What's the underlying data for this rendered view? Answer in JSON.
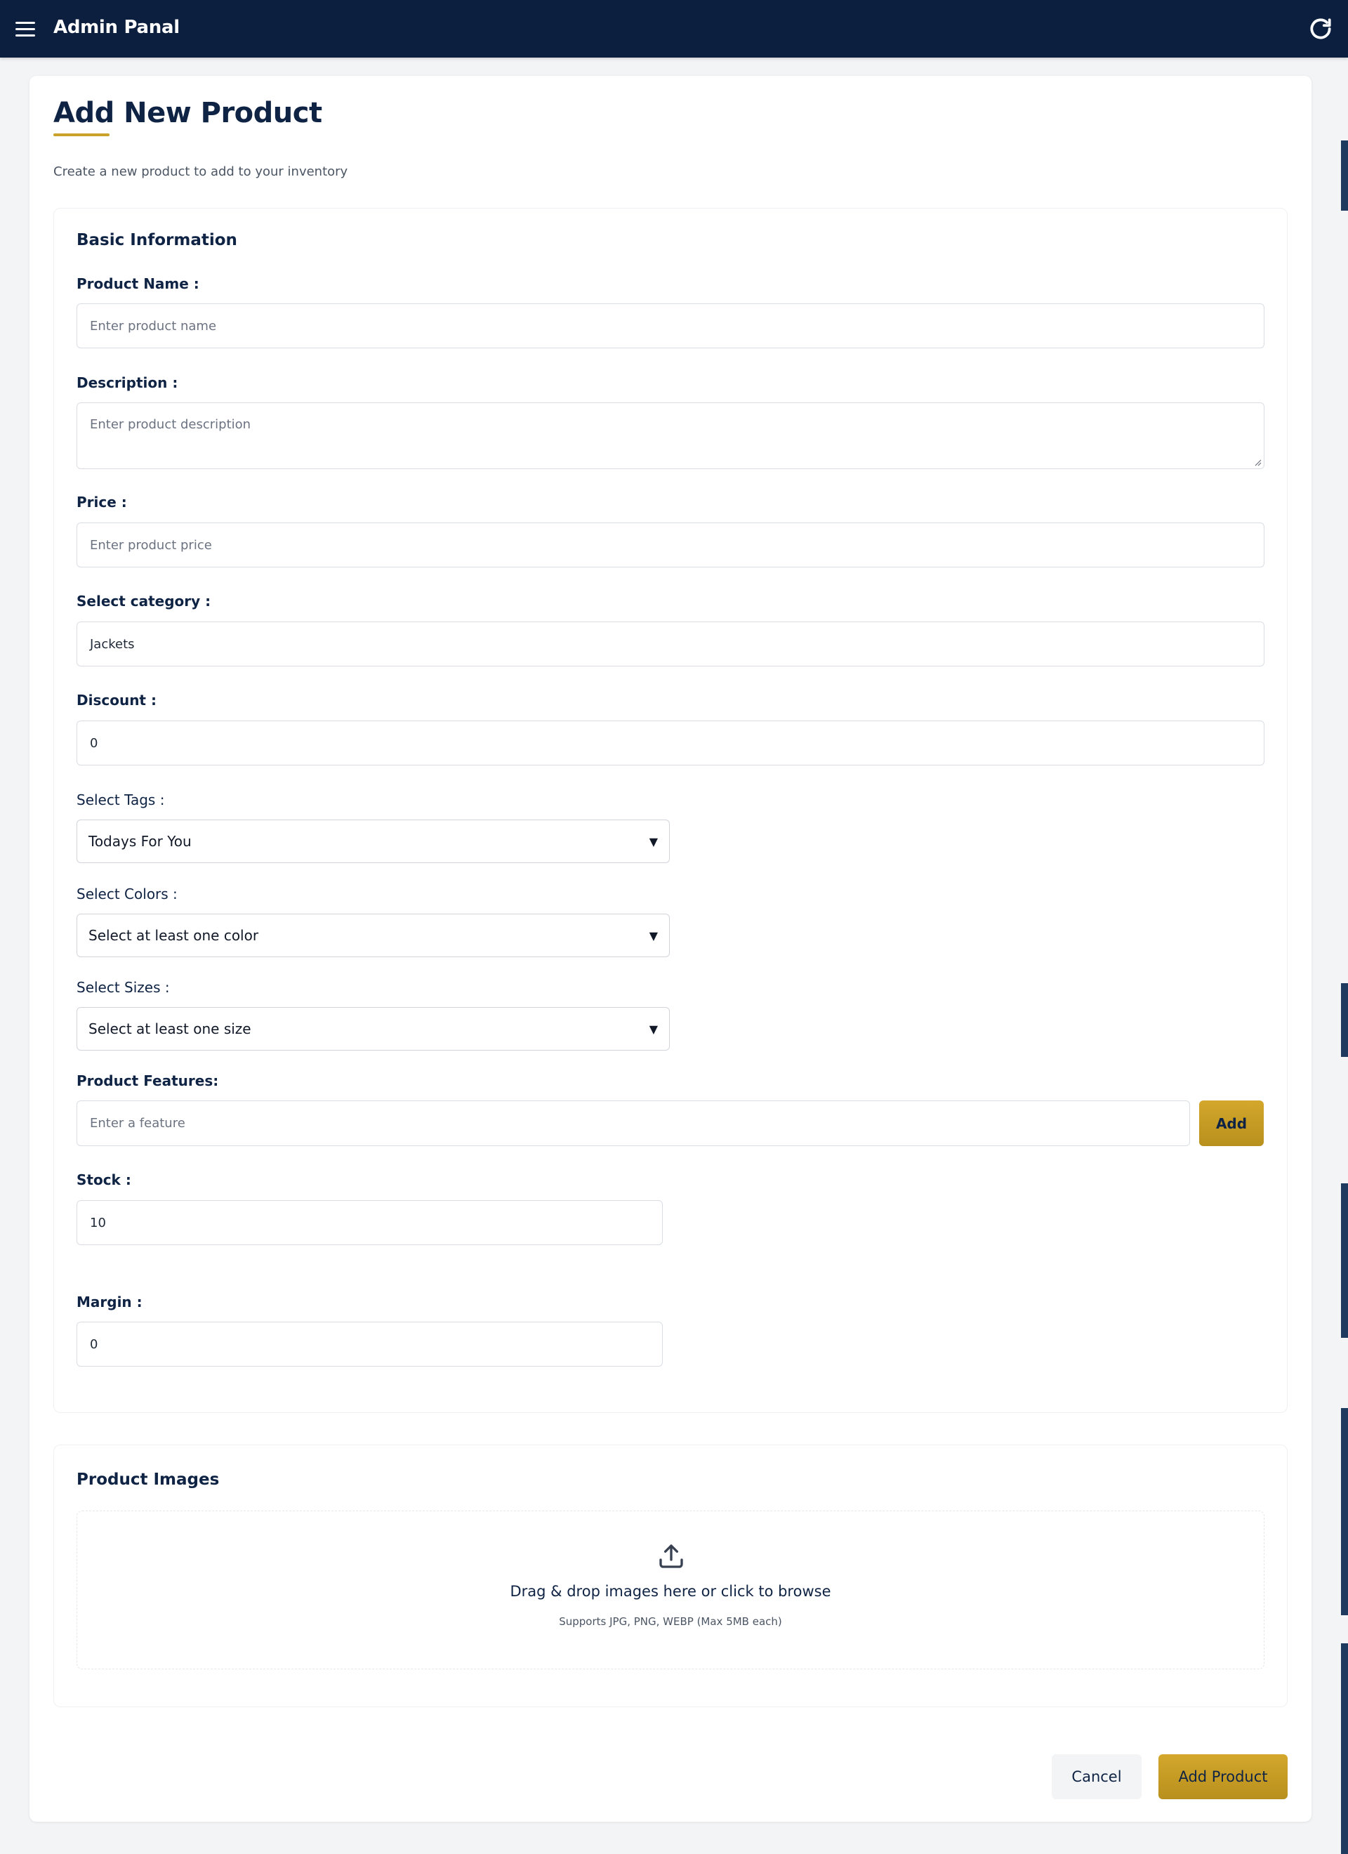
{
  "header": {
    "app_title": "Admin Panal",
    "menu_icon": "hamburger-menu-icon",
    "refresh_icon": "refresh-icon"
  },
  "page": {
    "title": "Add New Product",
    "subtitle": "Create a new product to add to your inventory"
  },
  "basic_info": {
    "title": "Basic Information",
    "product_name": {
      "label": "Product Name :",
      "placeholder": "Enter product name",
      "value": ""
    },
    "description": {
      "label": "Description :",
      "placeholder": "Enter product description",
      "value": ""
    },
    "price": {
      "label": "Price :",
      "placeholder": "Enter product price",
      "value": ""
    },
    "category": {
      "label": "Select category :",
      "value": "Jackets"
    },
    "discount": {
      "label": "Discount :",
      "value": "0"
    },
    "tags": {
      "label": "Select Tags :",
      "selected": "Todays For You"
    },
    "colors": {
      "label": "Select Colors :",
      "selected": "Select at least one color"
    },
    "sizes": {
      "label": "Select Sizes :",
      "selected": "Select at least one size"
    },
    "features": {
      "label": "Product Features:",
      "placeholder": "Enter a feature",
      "add_label": "Add"
    },
    "stock": {
      "label": "Stock :",
      "value": "10"
    },
    "margin": {
      "label": "Margin :",
      "value": "0"
    },
    "dropdown_arrow": "▼"
  },
  "images": {
    "title": "Product Images",
    "upload_icon": "upload-icon",
    "drop_text": "Drag & drop images here or click to browse",
    "drop_hint": "Supports JPG, PNG, WEBP (Max 5MB each)"
  },
  "actions": {
    "cancel_label": "Cancel",
    "submit_label": "Add Product"
  },
  "colors": {
    "header_bg": "#0d1f3e",
    "accent_gold": "#c9a227",
    "text_navy": "#0f2344"
  }
}
